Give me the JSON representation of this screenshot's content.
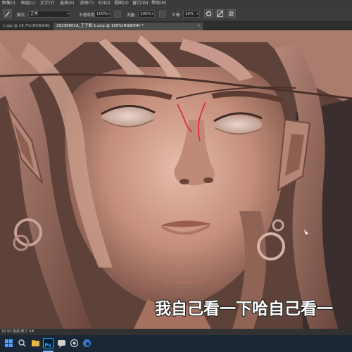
{
  "menubar": {
    "items": [
      "图像(I)",
      "图层(L)",
      "文字(Y)",
      "选择(S)",
      "滤镜(T)",
      "3D(D)",
      "视图(V)",
      "窗口(W)",
      "帮助(H)"
    ]
  },
  "options": {
    "mode_label": "模式:",
    "mode_value": "正常",
    "opacity_label": "不透明度:",
    "opacity_value": "100%",
    "flow_label": "流量:",
    "flow_value": "100%",
    "smoothing_label": "平滑:",
    "smoothing_value": "10%"
  },
  "tabs": [
    {
      "label": "1.jpg @ 16.7%(RGB/8#)",
      "active": false
    },
    {
      "label": "20230601A_王子郎-1.png @ 100%(RGB/8#) *",
      "active": true
    }
  ],
  "subtitle": "我自己看一下哈自己看一",
  "status": "16.95 像素/英寸 4#",
  "icons": {
    "windows": "windows-start-icon",
    "photoshop": "photoshop-icon",
    "browser": "edge-icon"
  },
  "colors": {
    "skin_light": "#d9aa98",
    "skin_mid": "#b07a68",
    "skin_dark": "#6e4a40",
    "brush_stroke": "#e0242a",
    "ps_blue": "#31a8ff",
    "taskbar_bg": "#1b2636"
  }
}
